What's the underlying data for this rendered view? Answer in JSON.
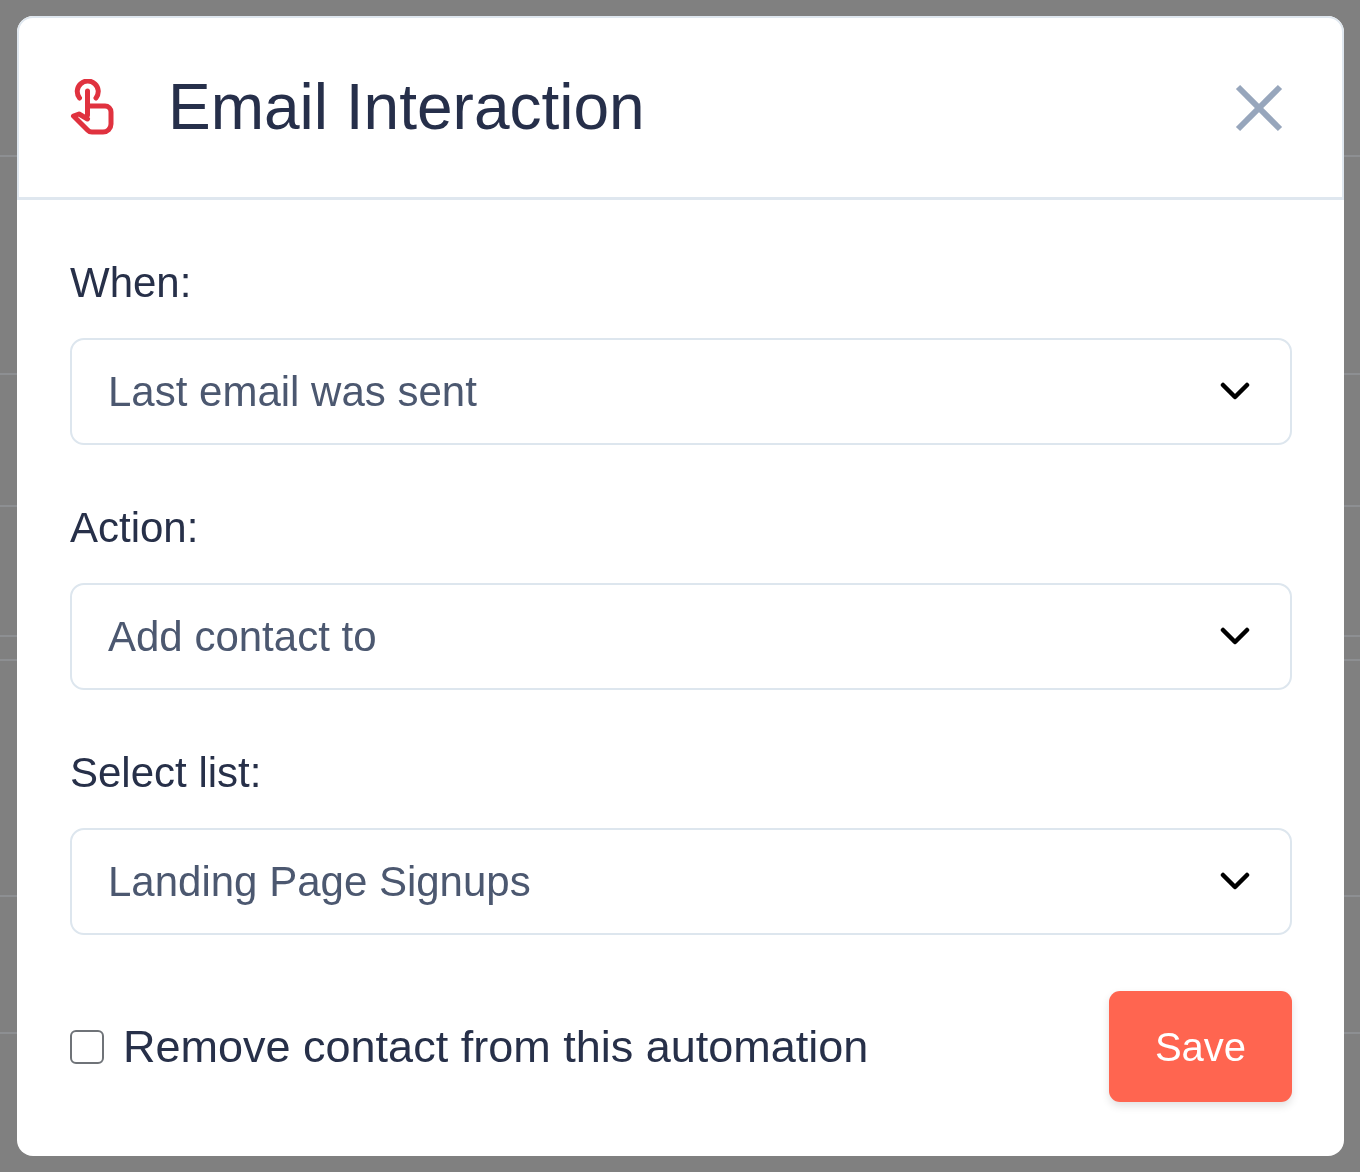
{
  "modal": {
    "title": "Email Interaction",
    "fields": [
      {
        "label": "When:",
        "value": "Last email was sent"
      },
      {
        "label": "Action:",
        "value": "Add contact to"
      },
      {
        "label": "Select list:",
        "value": "Landing Page Signups"
      }
    ],
    "remove_option": {
      "label": "Remove contact from this automation",
      "checked": false
    },
    "save_button": "Save"
  }
}
